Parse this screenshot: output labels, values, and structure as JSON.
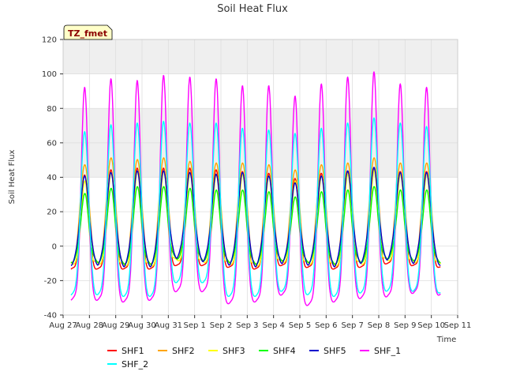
{
  "chart_data": {
    "type": "line",
    "title": "Soil Heat Flux",
    "xlabel": "Time",
    "ylabel": "Soil Heat Flux",
    "site_label": "TZ_fmet",
    "ylim": [
      -40,
      120
    ],
    "yticks": [
      -40,
      -20,
      0,
      20,
      40,
      60,
      80,
      100,
      120
    ],
    "xlim": [
      0,
      15
    ],
    "xticks": [
      {
        "x": 0,
        "label": "Aug 27"
      },
      {
        "x": 1,
        "label": "Aug 28"
      },
      {
        "x": 2,
        "label": "Aug 29"
      },
      {
        "x": 3,
        "label": "Aug 30"
      },
      {
        "x": 4,
        "label": "Aug 31"
      },
      {
        "x": 5,
        "label": "Sep 1"
      },
      {
        "x": 6,
        "label": "Sep 2"
      },
      {
        "x": 7,
        "label": "Sep 3"
      },
      {
        "x": 8,
        "label": "Sep 4"
      },
      {
        "x": 9,
        "label": "Sep 5"
      },
      {
        "x": 10,
        "label": "Sep 6"
      },
      {
        "x": 11,
        "label": "Sep 7"
      },
      {
        "x": 12,
        "label": "Sep 8"
      },
      {
        "x": 13,
        "label": "Sep 9"
      },
      {
        "x": 14,
        "label": "Sep 10"
      },
      {
        "x": 15,
        "label": "Sep 11"
      }
    ],
    "grid": true,
    "shaded_bands": [
      [
        40,
        80
      ],
      [
        100,
        120
      ]
    ],
    "legend_position": "bottom",
    "data_x_range": [
      0.3,
      14.35
    ],
    "day_centers": [
      0.82,
      1.82,
      2.82,
      3.82,
      4.82,
      5.82,
      6.82,
      7.82,
      8.82,
      9.82,
      10.82,
      11.82,
      12.82,
      13.82
    ],
    "series": [
      {
        "name": "SHF1",
        "color": "#ff0000",
        "order": 1,
        "peaks": [
          42,
          45,
          46,
          46,
          46,
          45,
          44,
          43,
          40,
          43,
          44,
          46,
          44,
          44
        ],
        "troughs": [
          -14,
          -14,
          -14,
          -12,
          -12,
          -13,
          -14,
          -12,
          -13,
          -14,
          -13,
          -11,
          -12,
          -13
        ]
      },
      {
        "name": "SHF2",
        "color": "#ffa500",
        "order": 2,
        "peaks": [
          48,
          52,
          51,
          52,
          50,
          49,
          49,
          48,
          45,
          48,
          49,
          52,
          49,
          49
        ],
        "troughs": [
          -11,
          -12,
          -12,
          -9,
          -10,
          -11,
          -12,
          -10,
          -11,
          -12,
          -11,
          -9,
          -10,
          -11
        ]
      },
      {
        "name": "SHF3",
        "color": "#ffff00",
        "order": 3,
        "peaks": [
          38,
          43,
          44,
          44,
          43,
          42,
          42,
          41,
          38,
          41,
          42,
          44,
          42,
          42
        ],
        "troughs": [
          -10,
          -11,
          -11,
          -8,
          -9,
          -10,
          -11,
          -9,
          -10,
          -11,
          -10,
          -8,
          -9,
          -10
        ]
      },
      {
        "name": "SHF4",
        "color": "#00ff00",
        "order": 4,
        "peaks": [
          30,
          33,
          34,
          34,
          33,
          32,
          32,
          31,
          28,
          31,
          32,
          34,
          32,
          32
        ],
        "troughs": [
          -9,
          -10,
          -10,
          -7,
          -8,
          -9,
          -10,
          -8,
          -9,
          -10,
          -9,
          -7,
          -8,
          -9
        ]
      },
      {
        "name": "SHF5",
        "color": "#0000cd",
        "order": 5,
        "peaks": [
          40,
          42,
          43,
          43,
          42,
          41,
          42,
          40,
          36,
          40,
          43,
          45,
          42,
          42
        ],
        "troughs": [
          -11,
          -12,
          -12,
          -7,
          -9,
          -11,
          -12,
          -10,
          -11,
          -12,
          -10,
          -8,
          -10,
          -11
        ]
      },
      {
        "name": "SHF_1",
        "color": "#ff00ff",
        "order": 6,
        "peaks": [
          92,
          97,
          96,
          99,
          98,
          97,
          93,
          93,
          87,
          94,
          98,
          101,
          94,
          92
        ],
        "troughs": [
          -31,
          -32,
          -31,
          -26,
          -26,
          -33,
          -32,
          -28,
          -34,
          -32,
          -30,
          -29,
          -27,
          -28
        ]
      },
      {
        "name": "SHF_2",
        "color": "#00ffff",
        "order": 7,
        "peaks": [
          67,
          71,
          72,
          73,
          72,
          72,
          69,
          68,
          66,
          69,
          72,
          75,
          72,
          70
        ],
        "troughs": [
          -29,
          -30,
          -30,
          -22,
          -22,
          -30,
          -30,
          -27,
          -29,
          -30,
          -28,
          -27,
          -27,
          -28
        ]
      }
    ]
  }
}
